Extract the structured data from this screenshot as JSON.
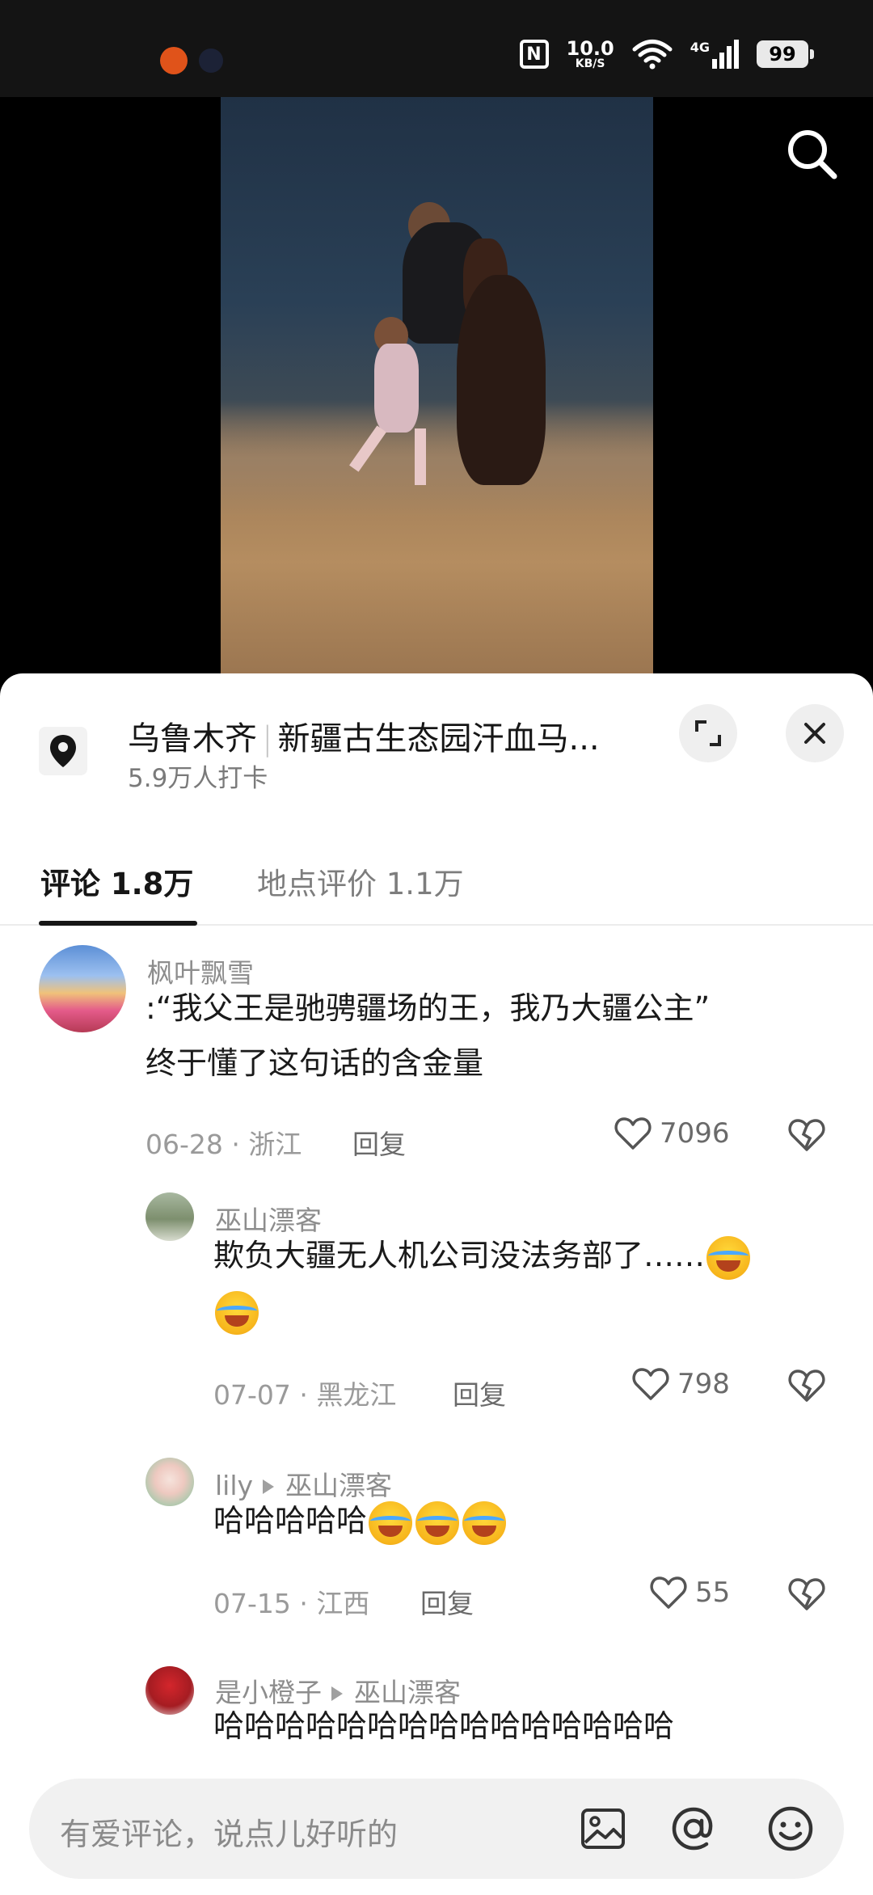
{
  "status_bar": {
    "speed_value": "10.0",
    "speed_unit": "KB/S",
    "network": "4G",
    "battery": "99"
  },
  "location": {
    "city": "乌鲁木齐",
    "name": "新疆古生态园汗血马...",
    "checkins": "5.9万人打卡"
  },
  "tabs": [
    {
      "label": "评论 1.8万",
      "active": true
    },
    {
      "label": "地点评价 1.1万",
      "active": false
    }
  ],
  "comments": [
    {
      "user": "枫叶飘雪",
      "text_line1": ":“我父王是驰骋疆场的王，我乃大疆公主”",
      "text_line2": "终于懂了这句话的含金量",
      "date_loc": "06-28 · 浙江",
      "reply": "回复",
      "likes": "7096"
    },
    {
      "user": "巫山漂客",
      "text_line1": "欺负大疆无人机公司没法务部了……",
      "date_loc": "07-07 · 黑龙江",
      "reply": "回复",
      "likes": "798"
    },
    {
      "user": "lily",
      "reply_to": "巫山漂客",
      "text_line1": "哈哈哈哈哈",
      "date_loc": "07-15 · 江西",
      "reply": "回复",
      "likes": "55"
    },
    {
      "user": "是小橙子",
      "reply_to": "巫山漂客",
      "text_line1": "哈哈哈哈哈哈哈哈哈哈哈哈哈哈哈"
    }
  ],
  "input": {
    "placeholder": "有爱评论，说点儿好听的"
  },
  "icons": [
    "search-icon",
    "location-pin-icon",
    "expand-icon",
    "close-icon",
    "heart-icon",
    "broken-heart-icon",
    "image-icon",
    "at-icon",
    "emoji-icon"
  ]
}
